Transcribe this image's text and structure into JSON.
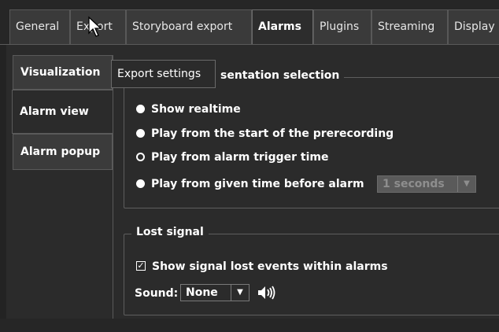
{
  "tabs": [
    "General",
    "Export",
    "Storyboard export",
    "Alarms",
    "Plugins",
    "Streaming",
    "Display"
  ],
  "active_tab": "Alarms",
  "side_tabs": [
    "Visualization",
    "Alarm view",
    "Alarm popup"
  ],
  "active_side_tab": "Alarm view",
  "tooltip": "Export settings",
  "presentation": {
    "legend": "sentation selection",
    "options": [
      "Show realtime",
      "Play from the start of the prerecording",
      "Play from alarm trigger time",
      "Play from given time before alarm"
    ],
    "selected": "Play from alarm trigger time",
    "seconds_value": "1 seconds"
  },
  "lost_signal": {
    "legend": "Lost signal",
    "checkbox_label": "Show signal lost events within alarms",
    "checkbox_checked": true,
    "sound_label": "Sound:",
    "sound_value": "None"
  },
  "icons": {
    "dropdown": "chevron-down-icon",
    "speaker": "speaker-icon",
    "cursor": "mouse-pointer-icon"
  }
}
